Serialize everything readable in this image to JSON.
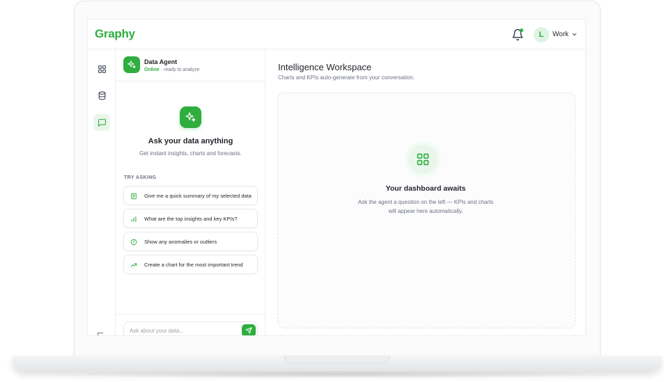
{
  "app": {
    "logo_text": "Graphy",
    "brand_color": "#2fae3f"
  },
  "topbar": {
    "notification_icon": "bell-icon",
    "avatar_initial": "L",
    "workspace_label": "Work",
    "menu_icon": "chevron-down-icon"
  },
  "rail": {
    "items": [
      {
        "icon": "grid-icon",
        "active": false
      },
      {
        "icon": "database-icon",
        "active": false
      },
      {
        "icon": "chat-icon",
        "active": true
      }
    ]
  },
  "agent": {
    "name": "Data Agent",
    "status_online": "Online",
    "status_text": "· ready to analyze"
  },
  "chat_empty": {
    "title": "Ask your data anything",
    "subtitle": "Get instant insights, charts and forecasts.",
    "try_label": "TRY ASKING",
    "suggestions": [
      {
        "icon": "document-icon",
        "label": "Give me a quick summary of my selected data"
      },
      {
        "icon": "bar-chart-icon",
        "label": "What are the top insights and key KPIs?"
      },
      {
        "icon": "alert-circle-icon",
        "label": "Show any anomalies or outliers"
      },
      {
        "icon": "trend-up-icon",
        "label": "Create a chart for the most important trend"
      }
    ]
  },
  "chat_input": {
    "placeholder": "Ask about your data...",
    "value": ""
  },
  "workspace": {
    "title": "Intelligence Workspace",
    "subtitle": "Charts and KPIs auto-generate from your conversation.",
    "empty_title": "Your dashboard awaits",
    "empty_line1": "Ask the agent a question on the left — KPIs and charts",
    "empty_line2": "will appear here automatically."
  }
}
